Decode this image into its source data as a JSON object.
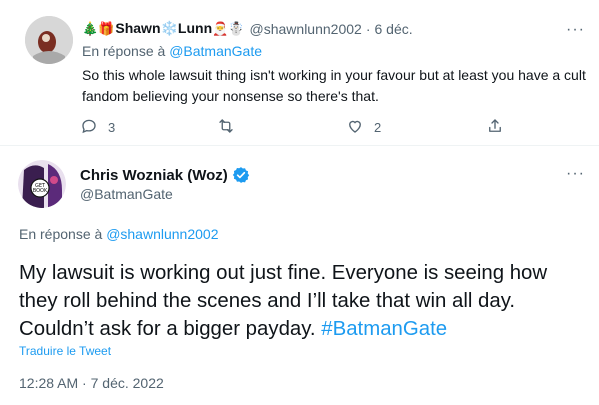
{
  "reply_tweet": {
    "author_name": "Shawn❄️Lunn",
    "author_emoji_prefix": "🎄🎁",
    "author_emoji_suffix": "🎅☃️",
    "handle": "@shawnlunn2002",
    "separator": "·",
    "date": "6 déc.",
    "in_reply_prefix": "En réponse à",
    "in_reply_handle": "@BatmanGate",
    "text": "So this whole lawsuit thing isn't working in your favour but at least you have a cult fandom believing your nonsense so there's that.",
    "reply_count": "3",
    "retweet_count": "",
    "like_count": "2",
    "more_label": "···"
  },
  "main_tweet": {
    "author_name": "Chris Wozniak (Woz)",
    "handle": "@BatmanGate",
    "more_label": "···",
    "in_reply_prefix": "En réponse à",
    "in_reply_handle": "@shawnlunn2002",
    "text_main": "My lawsuit is working out just fine. Everyone is seeing how they roll behind the scenes and I’ll take that win all day. Couldn’t ask for a bigger payday.",
    "hashtag": "#BatmanGate",
    "translate_label": "Traduire le Tweet",
    "time": "12:28 AM",
    "separator": "·",
    "date": "7 déc. 2022"
  },
  "colors": {
    "accent": "#1d9bf0",
    "secondary_text": "#536471",
    "primary_text": "#0f1419",
    "verified": "#1d9bf0"
  }
}
